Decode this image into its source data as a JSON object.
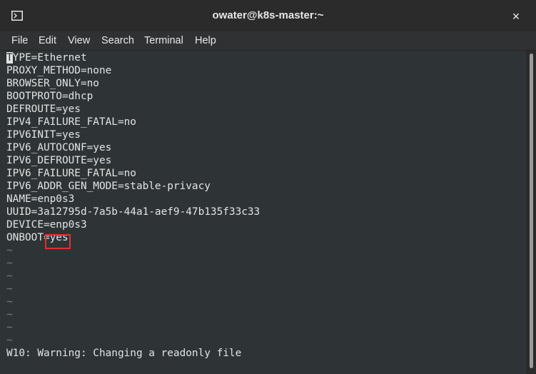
{
  "window": {
    "title": "owater@k8s-master:~",
    "close_label": "×"
  },
  "menu": [
    "File",
    "Edit",
    "View",
    "Search",
    "Terminal",
    "Help"
  ],
  "terminal": {
    "cursor_char": "T",
    "lines": [
      "YPE=Ethernet",
      "PROXY_METHOD=none",
      "BROWSER_ONLY=no",
      "BOOTPROTO=dhcp",
      "DEFROUTE=yes",
      "IPV4_FAILURE_FATAL=no",
      "IPV6INIT=yes",
      "IPV6_AUTOCONF=yes",
      "IPV6_DEFROUTE=yes",
      "IPV6_FAILURE_FATAL=no",
      "IPV6_ADDR_GEN_MODE=stable-privacy",
      "NAME=enp0s3",
      "UUID=3a12795d-7a5b-44a1-aef9-47b135f33c33",
      "DEVICE=enp0s3",
      "ONBOOT=yes"
    ],
    "tildes": [
      "~",
      "~",
      "~",
      "~",
      "~",
      "~",
      "~",
      "~"
    ],
    "status": "W10: Warning: Changing a readonly file"
  },
  "colors": {
    "terminal_bg": "#2e3436",
    "text": "#e3e3e3",
    "highlight": "#e03030"
  }
}
